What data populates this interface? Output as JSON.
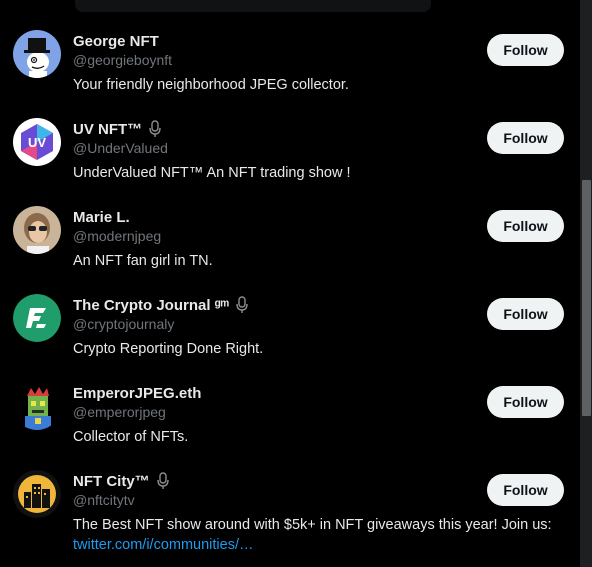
{
  "accounts": [
    {
      "name": "George NFT",
      "handle": "@georgieboynft",
      "bio": "Your friendly neighborhood JPEG collector.",
      "follow_label": "Follow",
      "avatar": "top-hat-character-avatar"
    },
    {
      "name": "UV NFT™",
      "handle": "@UnderValued",
      "bio": "UnderValued NFT™ An NFT trading show !",
      "follow_label": "Follow",
      "avatar": "uv-logo-avatar",
      "badge": "microphone-icon"
    },
    {
      "name": "Marie L.",
      "handle": "@modernjpeg",
      "bio": "An NFT fan girl in TN.",
      "follow_label": "Follow",
      "avatar": "photo-avatar"
    },
    {
      "name": "The Crypto Journal ᵍᵐ",
      "handle": "@cryptojournaly",
      "bio": "Crypto Reporting Done Right.",
      "follow_label": "Follow",
      "avatar": "crypto-journal-logo-avatar",
      "badge": "microphone-icon"
    },
    {
      "name": "EmperorJPEG.eth",
      "handle": "@emperorjpeg",
      "bio": "Collector of NFTs.",
      "follow_label": "Follow",
      "avatar": "pixel-character-avatar"
    },
    {
      "name": "NFT City™",
      "handle": "@nftcitytv",
      "bio": "The Best NFT show around with $5k+ in NFT giveaways this year! Join us: ",
      "bio_link": "twitter.com/i/communities/…",
      "follow_label": "Follow",
      "avatar": "city-skyline-avatar",
      "badge": "microphone-icon"
    }
  ],
  "colors": {
    "background": "#000000",
    "text": "#e7e9ea",
    "secondary_text": "#71767b",
    "link": "#1d9bf0",
    "button_bg": "#eff3f4",
    "button_text": "#0f1419"
  }
}
